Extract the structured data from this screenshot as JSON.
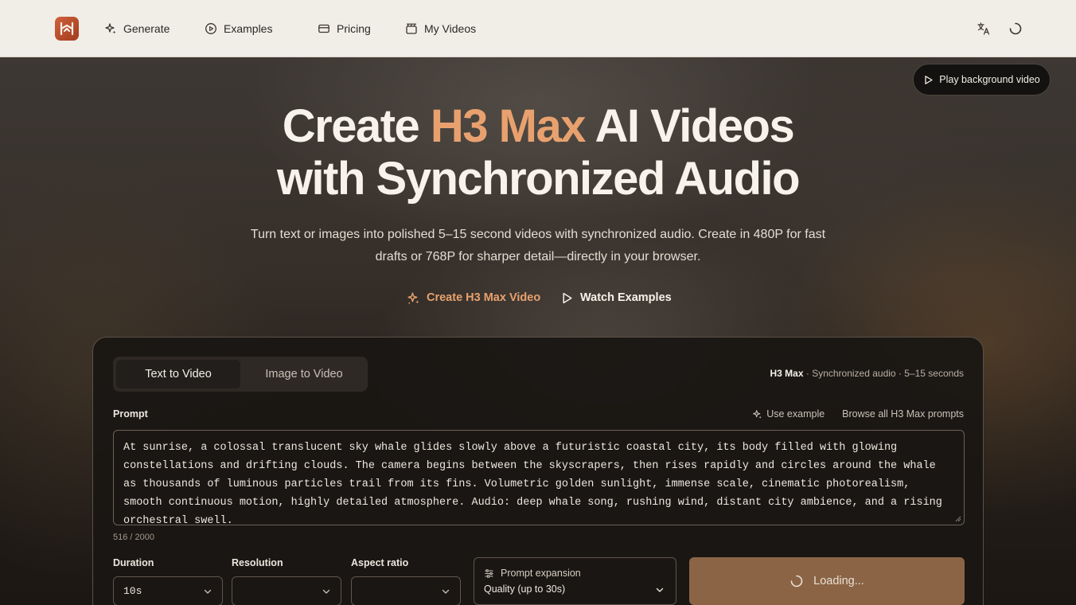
{
  "header": {
    "logo_letter": "H",
    "nav": [
      {
        "label": "Generate",
        "icon": "sparkles-icon"
      },
      {
        "label": "Examples",
        "icon": "play-circle-icon"
      },
      {
        "label": "Pricing",
        "icon": "credit-card-icon"
      },
      {
        "label": "My Videos",
        "icon": "video-library-icon"
      }
    ],
    "icons": [
      "translate-icon",
      "loading-spinner-icon"
    ]
  },
  "hero": {
    "play_background_label": "Play background video",
    "headline_part1": "Create ",
    "headline_accent": "H3 Max",
    "headline_part2": " AI Videos",
    "headline_line2": "with Synchronized Audio",
    "subtitle": "Turn text or images into polished 5–15 second videos with synchronized audio. Create in 480P for fast drafts or 768P for sharper detail—directly in your browser.",
    "cta_create": "Create H3 Max Video",
    "cta_watch": "Watch Examples",
    "accent_color": "#e8a16e"
  },
  "generator": {
    "tabs": [
      {
        "label": "Text to Video",
        "active": true
      },
      {
        "label": "Image to Video",
        "active": false
      }
    ],
    "model_name": "H3 Max",
    "model_details": " · Synchronized audio · 5–15 seconds",
    "prompt_label": "Prompt",
    "use_example_label": "Use example",
    "browse_prompts_label": "Browse all H3 Max prompts",
    "prompt_text": "At sunrise, a colossal translucent sky whale glides slowly above a futuristic coastal city, its body filled with glowing constellations and drifting clouds. The camera begins between the skyscrapers, then rises rapidly and circles around the whale as thousands of luminous particles trail from its fins. Volumetric golden sunlight, immense scale, cinematic photorealism, smooth continuous motion, highly detailed atmosphere. Audio: deep whale song, rushing wind, distant city ambience, and a rising orchestral swell.",
    "char_count": "516 / 2000",
    "duration_label": "Duration",
    "duration_value": "10s",
    "resolution_label": "Resolution",
    "resolution_value": "",
    "aspect_label": "Aspect ratio",
    "aspect_value": "",
    "expansion_label": "Prompt expansion",
    "expansion_value": "Quality (up to 30s)",
    "generate_label": "Loading...",
    "button_color": "#8b6446"
  }
}
